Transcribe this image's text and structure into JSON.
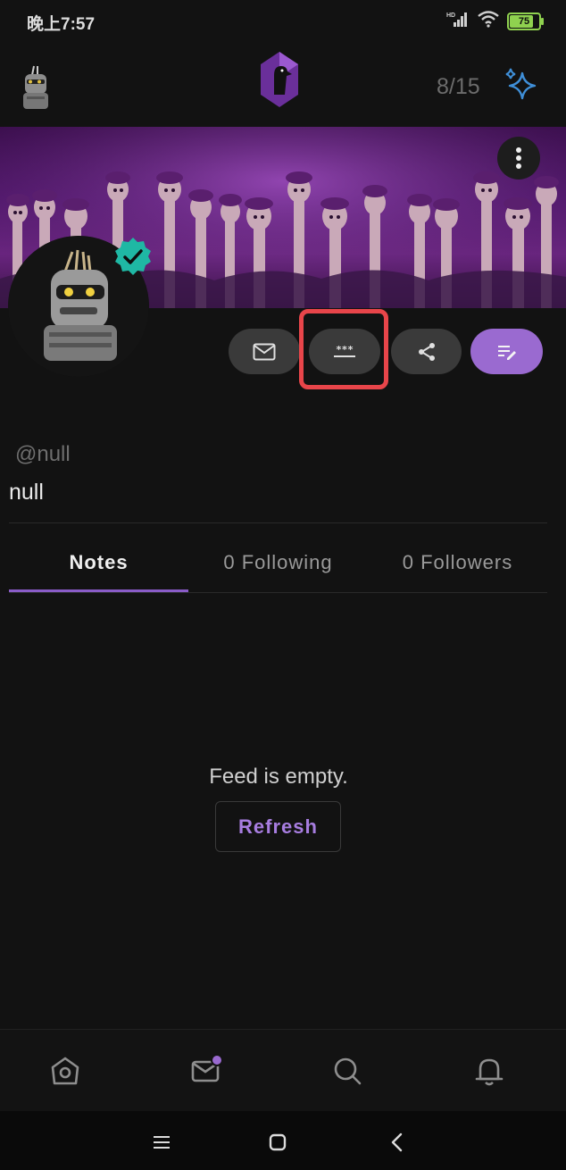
{
  "status_bar": {
    "time": "晚上7:57",
    "battery_level": "75",
    "network": "HD"
  },
  "header": {
    "counter": "8/15"
  },
  "profile": {
    "handle": "@null",
    "display_name": "null",
    "verified": true
  },
  "actions": {
    "message_icon": "envelope-icon",
    "password_icon": "password-icon",
    "share_icon": "share-icon",
    "edit_icon": "edit-icon"
  },
  "tabs": [
    {
      "label": "Notes",
      "active": true
    },
    {
      "label": "0 Following",
      "active": false
    },
    {
      "label": "0 Followers",
      "active": false
    }
  ],
  "feed": {
    "empty_text": "Feed is empty.",
    "refresh_label": "Refresh"
  },
  "bottom_nav": {
    "items": [
      "home-icon",
      "messages-icon",
      "search-icon",
      "notifications-icon"
    ],
    "messages_has_badge": true
  },
  "colors": {
    "accent": "#9a6ad0",
    "highlight": "#e8454a",
    "verified": "#1fb8a4"
  }
}
